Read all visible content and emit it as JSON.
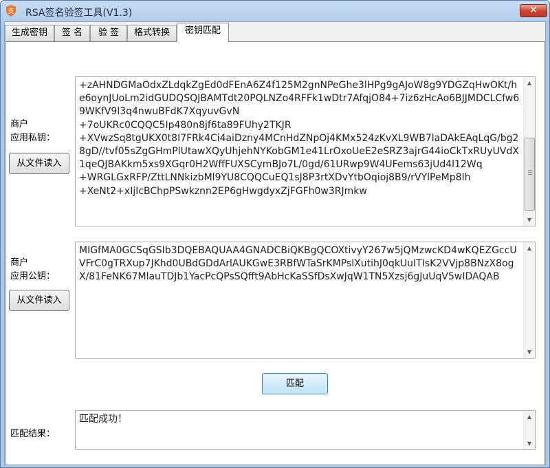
{
  "window": {
    "title": "RSA签名验签工具(V1.3)",
    "close_label": "✕",
    "accent_color": "#aac9e8"
  },
  "tabs": [
    {
      "label": "生成密钥",
      "active": false
    },
    {
      "label": "签 名",
      "active": false
    },
    {
      "label": "验 签",
      "active": false
    },
    {
      "label": "格式转换",
      "active": false
    },
    {
      "label": "密钥匹配",
      "active": true
    }
  ],
  "private_key": {
    "label_line1": "商户",
    "label_line2": "应用私钥：",
    "load_button": "从文件读入",
    "value": "+zAHNDGMaOdxZLdqkZgEd0dFEnA6Z4f125M2gnNPeGhe3lHPg9gAJoW8g9YDGZqHwOKt/he6oynJUoLm2idGUDQSQJBAMTdt20PQLNZo4RFFk1wDtr7AfqjO84+7iz6zHcAo6BJJMDCLCfw69WKfV9l3q4nwuBFdK7XqyuvGvN\n+7oUKRc0CQQC5Ip480n8jf6ta89FUhy2TKJR\n+XVwzSq8tgUKX0t8I7FRk4Ci4aiDzny4MCnHdZNpOj4KMx524zKvXL9WB7laDAkEAqLqG/bg28gD//tvf05sZgGHmPlUtawXQyUhjehNYKobGM1e41LrOxoUeE2eSRZ3ajrG44ioCkTxRUyUVdX1qeQJBAKkm5xs9XGqr0H2WffFUXSCymBJo7L/0gd/61URwp9W4UFems63jUd4l12Wq\n+WRGLGxRFP/ZttLNNkizbMl9YU8CQQCuEQ1sJ8P3rtXDvYtbOqioj8B9/rVYlPeMp8Ih\n+XeNt2+xIjIcBChpPSwkznn2EP6gHwgdyxZjFGFh0w3RJmkw"
  },
  "public_key": {
    "label_line1": "商户",
    "label_line2": "应用公钥：",
    "load_button": "从文件读入",
    "value": "MIGfMA0GCSqGSIb3DQEBAQUAA4GNADCBiQKBgQCOXtivyY267w5jQMzwcKD4wKQEZGccUVFrC0gTRXup7JKhd0UBdGDdArlAUKGwE3RBfWTaSrKMPslXutihJ0qkUuITIsK2VVjp8BNzX8ogX/81FeNK67MlauTDJb1YacPcQPsSQfft9AbHcKaSSfDsXwJqW1TN5Xzsj6gJuUqV5wIDAQAB"
  },
  "match_button": "匹配",
  "result": {
    "label": "匹配结果：",
    "value": "匹配成功！"
  },
  "icons": {
    "app": "key-shield-icon",
    "scroll_up": "▲",
    "scroll_down": "▼"
  }
}
